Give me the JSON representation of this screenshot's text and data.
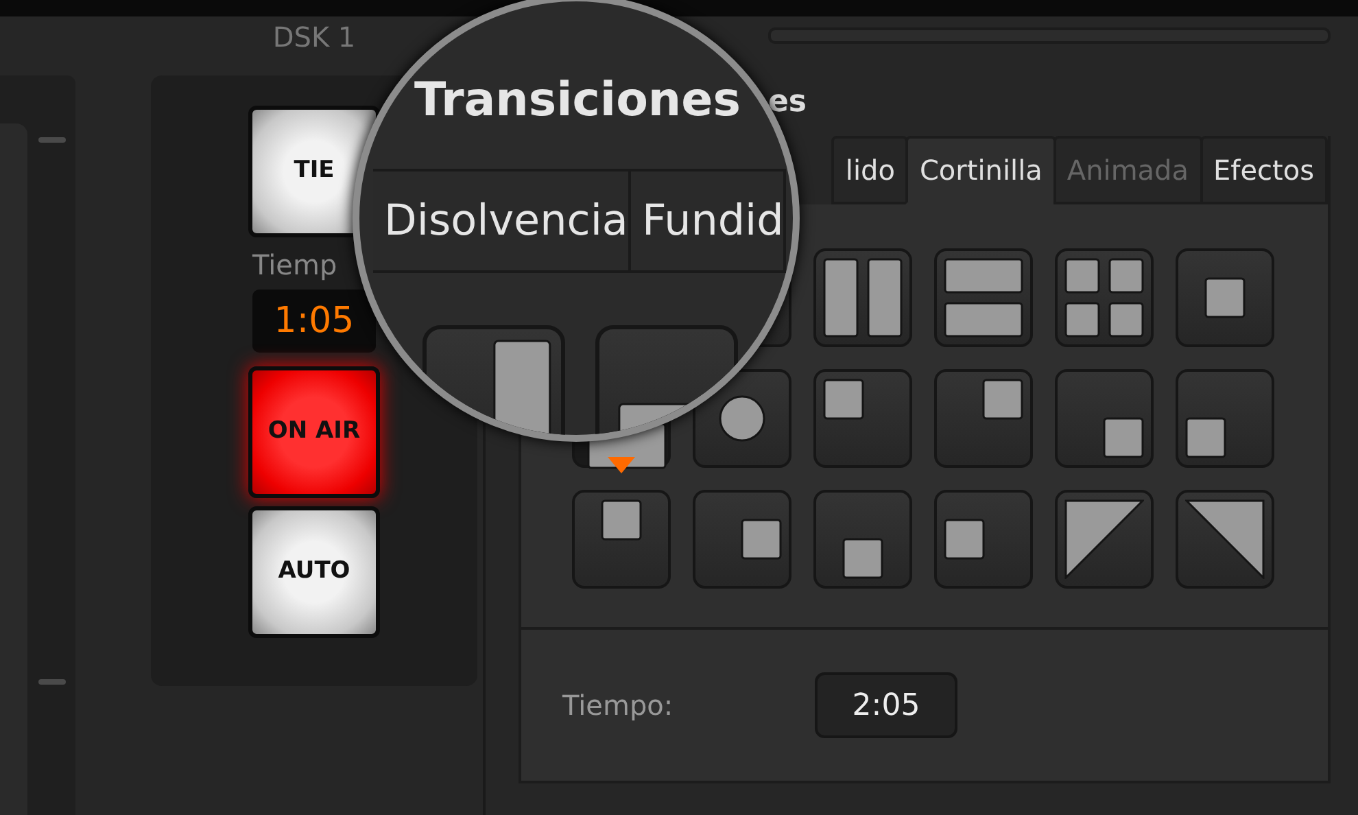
{
  "dsk": {
    "title": "DSK 1",
    "buttons": [
      {
        "label": "TIE",
        "on": false
      }
    ],
    "time_label": "Tiemp",
    "time": "1:05",
    "action_buttons": [
      {
        "label": "ON AIR",
        "on": true
      },
      {
        "label": "AUTO",
        "on": false
      }
    ]
  },
  "transitions": {
    "title": "es",
    "tabs": [
      {
        "label": "lido",
        "selected": false,
        "disabled": false
      },
      {
        "label": "Cortinilla",
        "selected": true,
        "disabled": false
      },
      {
        "label": "Animada",
        "selected": false,
        "disabled": true
      },
      {
        "label": "Efectos",
        "selected": false,
        "disabled": false
      }
    ],
    "wipes": [
      {
        "selected": false
      },
      {
        "kind": "two-vbars",
        "selected": false
      },
      {
        "kind": "two-hbars",
        "selected": false
      },
      {
        "kind": "quad",
        "selected": false
      },
      {
        "kind": "center",
        "selected": false
      },
      {
        "kind": "box-bottom",
        "selected": true
      },
      {
        "kind": "circle",
        "selected": false
      },
      {
        "kind": "tl",
        "selected": false
      },
      {
        "kind": "tr",
        "selected": false
      },
      {
        "kind": "br",
        "selected": false
      },
      {
        "kind": "bl",
        "selected": false
      },
      {
        "kind": "tc",
        "selected": false
      },
      {
        "kind": "rc",
        "selected": false
      },
      {
        "kind": "bc",
        "selected": false
      },
      {
        "kind": "lc",
        "selected": false
      },
      {
        "kind": "diag-tl",
        "selected": false
      },
      {
        "kind": "diag-tr",
        "selected": false
      }
    ],
    "time_label": "Tiempo:",
    "time": "2:05"
  },
  "magnifier": {
    "title": "Transiciones",
    "tabs": [
      {
        "label": "Disolvencia"
      },
      {
        "label": "Fundid"
      }
    ],
    "wipes": [
      {
        "kind": "bar-right"
      },
      {
        "kind": "box-bottom"
      }
    ]
  }
}
